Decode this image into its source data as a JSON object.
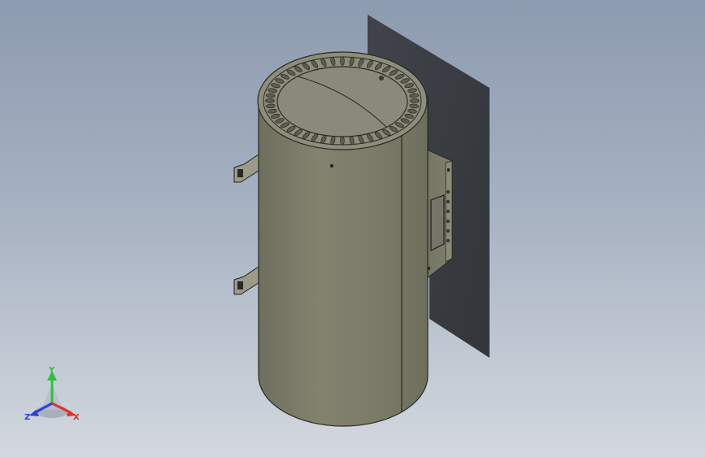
{
  "window": {
    "title": ""
  },
  "viewport": {
    "background_top": "#8d9bb0",
    "background_bottom": "#d3d8df"
  },
  "model": {
    "body_color": "#7d7d6a",
    "body_highlight": "#8e8e7b",
    "top_face_color": "#8a8a7a",
    "outline_color": "#2a2a24",
    "shadow_color": "#2c2f33",
    "components": [
      "cylindrical-body",
      "top-cap",
      "vented-rim",
      "mounting-bracket-upper",
      "mounting-bracket-lower",
      "control-box",
      "display-panel",
      "control-buttons",
      "wall-shadow"
    ]
  },
  "triad": {
    "x_label": "X",
    "y_label": "Y",
    "z_label": "Z",
    "x_color": "#e0302a",
    "y_color": "#2fbf3a",
    "z_color": "#2a3ee0"
  }
}
